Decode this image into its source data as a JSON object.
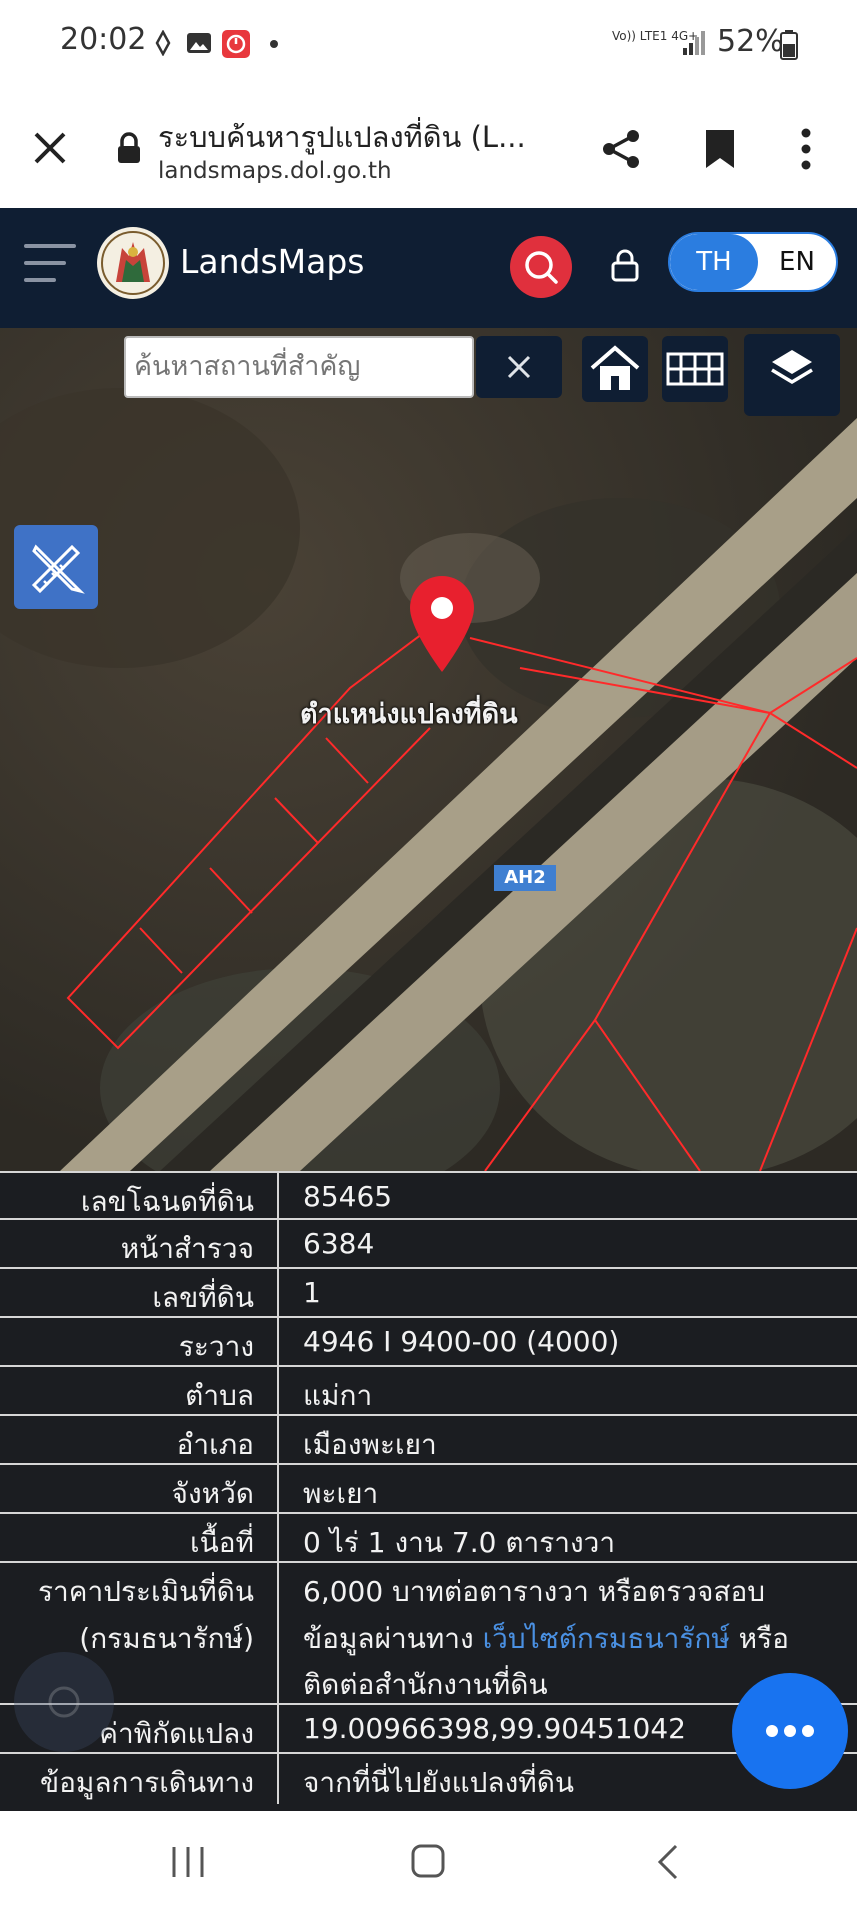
{
  "status_bar": {
    "time": "20:02",
    "network": "Vo)) LTE1 4G+",
    "battery": "52%"
  },
  "browser": {
    "page_title": "ระบบค้นหารูปแปลงที่ดิน (L...",
    "url": "landsmaps.dol.go.th"
  },
  "header": {
    "brand": "LandsMaps",
    "lang_th": "TH",
    "lang_en": "EN"
  },
  "map": {
    "search_placeholder": "ค้นหาสถานที่สำคัญ",
    "marker_label": "ตำแหน่งแปลงที่ดิน",
    "road_label": "AH2"
  },
  "parcel_info": {
    "rows": [
      {
        "label": "เลขโฉนดที่ดิน",
        "value": "85465"
      },
      {
        "label": "หน้าสำรวจ",
        "value": "6384"
      },
      {
        "label": "เลขที่ดิน",
        "value": "1"
      },
      {
        "label": "ระวาง",
        "value": "4946 I 9400-00 (4000)"
      },
      {
        "label": "ตำบล",
        "value": "แม่กา"
      },
      {
        "label": "อำเภอ",
        "value": "เมืองพะเยา"
      },
      {
        "label": "จังหวัด",
        "value": "พะเยา"
      },
      {
        "label": "เนื้อที่",
        "value": "0 ไร่ 1 งาน 7.0 ตารางวา"
      }
    ],
    "appraisal": {
      "label_line1": "ราคาประเมินที่ดิน",
      "label_line2": "(กรมธนารักษ์)",
      "value_line1": "6,000 บาทต่อตารางวา หรือตรวจสอบ",
      "value_line2_pre": "ข้อมูลผ่านทาง ",
      "value_link": "เว็บไซต์กรมธนารักษ์",
      "value_line2_post": " หรือ",
      "value_line3": "ติดต่อสำนักงานที่ดิน"
    },
    "coordinates": {
      "label": "ค่าพิกัดแปลง",
      "value": "19.00966398,99.90451042"
    },
    "directions": {
      "label": "ข้อมูลการเดินทาง",
      "value": "จากที่นี่ไปยังแปลงที่ดิน"
    }
  },
  "colors": {
    "header_bg": "#0f1e33",
    "accent_blue": "#2b7de0",
    "search_red": "#e0303d",
    "parcel_line": "#ff2a2a",
    "link_blue": "#4a90e2"
  }
}
